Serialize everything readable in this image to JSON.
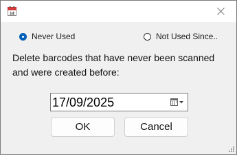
{
  "window": {
    "app_icon": "calendar-icon",
    "app_icon_text": "14",
    "close_icon": "close-icon"
  },
  "options": {
    "never_used": {
      "label": "Never Used",
      "selected": true
    },
    "not_used_since": {
      "label": "Not Used Since..",
      "selected": false
    }
  },
  "description": "Delete barcodes that have never been scanned and were created before:",
  "date_picker": {
    "value": "17/09/2025",
    "icon": "calendar-dropdown-icon"
  },
  "buttons": {
    "ok_label": "OK",
    "cancel_label": "Cancel"
  },
  "colors": {
    "accent": "#005fb8",
    "calendar_red": "#e03a3a"
  }
}
